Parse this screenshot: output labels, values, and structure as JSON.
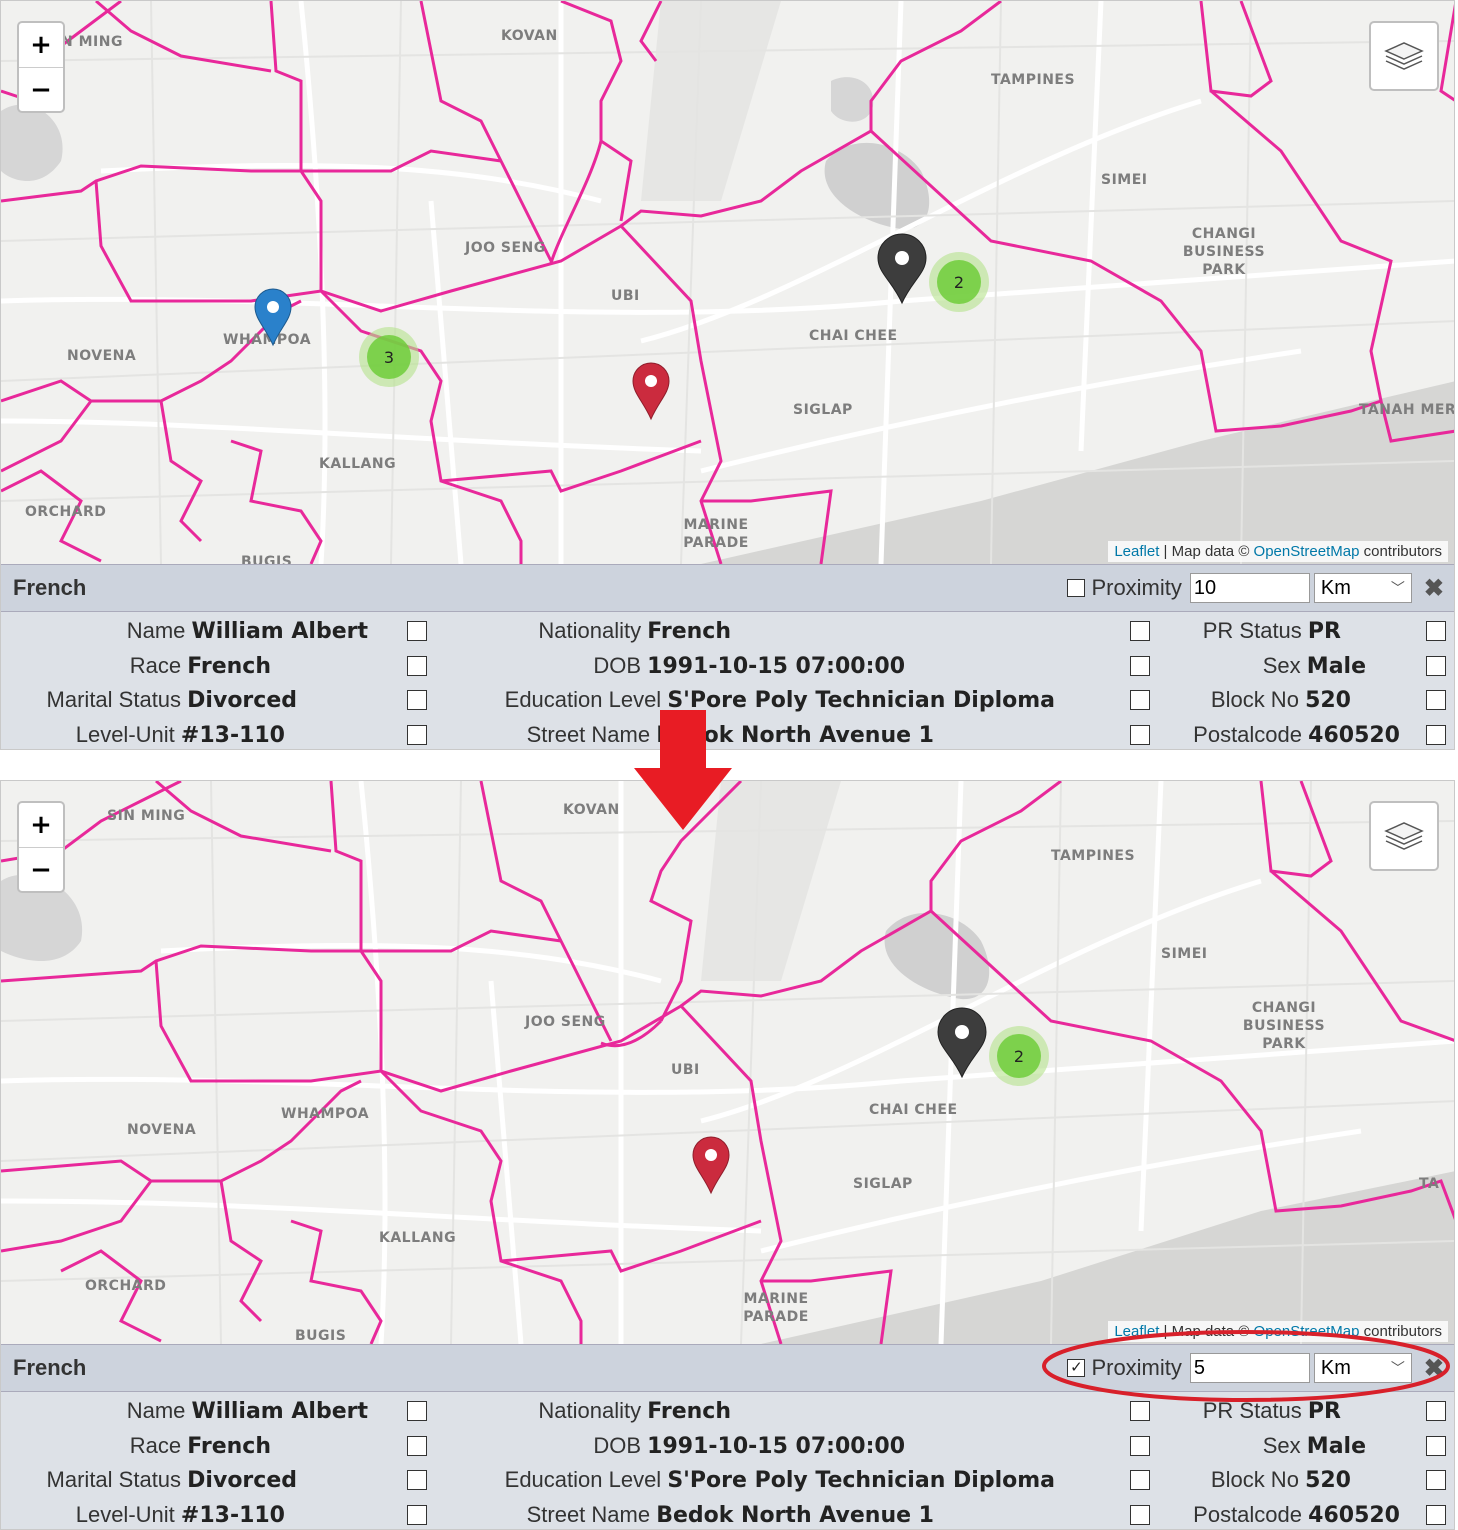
{
  "panels": [
    {
      "places": [
        "N MING",
        "KOVAN",
        "TAMPINES",
        "SIMEI",
        "CHANGI BUSINESS PARK",
        "JOO SENG",
        "UBI",
        "CHAI CHEE",
        "NOVENA",
        "WHAMPOA",
        "SIGLAP",
        "TANAH MERA",
        "KALLANG",
        "ORCHARD",
        "MARINE PARADE",
        "BUGIS"
      ],
      "clusters": [
        "3",
        "2"
      ],
      "attribution": {
        "leaflet": "Leaflet",
        "middle": " | Map data © ",
        "osm": "OpenStreetMap",
        "tail": " contributors"
      },
      "title": "French",
      "proximity": {
        "checked": false,
        "label": "Proximity",
        "value": "10",
        "unit": "Km"
      }
    },
    {
      "places": [
        "SIN MING",
        "KOVAN",
        "TAMPINES",
        "SIMEI",
        "CHANGI BUSINESS PARK",
        "JOO SENG",
        "UBI",
        "CHAI CHEE",
        "WHAMPOA",
        "NOVENA",
        "SIGLAP",
        "KALLANG",
        "ORCHARD",
        "MARINE PARADE",
        "BUGIS",
        "TA"
      ],
      "clusters": [
        "2"
      ],
      "attribution": {
        "leaflet": "Leaflet",
        "middle": " | Map data © ",
        "osm": "OpenStreetMap",
        "tail": " contributors"
      },
      "title": "French",
      "proximity": {
        "checked": true,
        "label": "Proximity",
        "value": "5",
        "unit": "Km"
      }
    }
  ],
  "zoom": {
    "plus": "+",
    "minus": "−"
  },
  "fields": {
    "name": {
      "label": "Name",
      "value": "William Albert"
    },
    "nationality": {
      "label": "Nationality",
      "value": "French"
    },
    "pr_status": {
      "label": "PR Status",
      "value": "PR"
    },
    "race": {
      "label": "Race",
      "value": "French"
    },
    "dob": {
      "label": "DOB",
      "value": "1991-10-15 07:00:00"
    },
    "sex": {
      "label": "Sex",
      "value": "Male"
    },
    "marital_status": {
      "label": "Marital Status",
      "value": "Divorced"
    },
    "education_level": {
      "label": "Education Level",
      "value": "S'Pore Poly Technician Diploma"
    },
    "block_no": {
      "label": "Block No",
      "value": "520"
    },
    "level_unit": {
      "label": "Level-Unit",
      "value": "#13-110"
    },
    "street_name": {
      "label": "Street Name",
      "value": "Bedok North Avenue 1"
    },
    "postalcode": {
      "label": "Postalcode",
      "value": "460520"
    }
  },
  "colors": {
    "boundary": "#e8289a",
    "arrow": "#e81c24",
    "ellipse": "#d8202a",
    "marker_blue": "#2a81cb",
    "marker_red": "#cb2b3e",
    "marker_black": "#3d3d3d"
  },
  "icons": [
    "layers-icon",
    "map-marker-icon",
    "down-arrow-icon",
    "close-icon",
    "chevron-down-icon",
    "check-icon"
  ]
}
